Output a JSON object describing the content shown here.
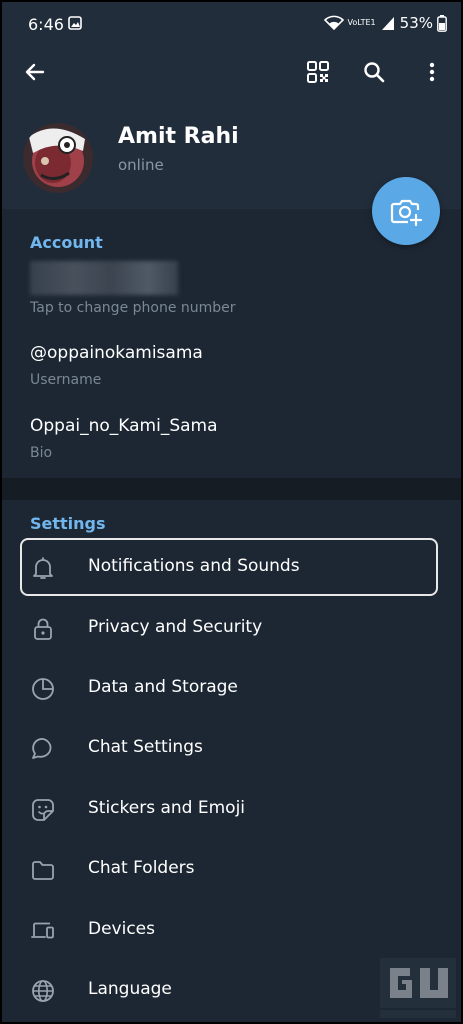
{
  "status_bar": {
    "time": "6:46",
    "battery": "53%",
    "network": "VoLTE1"
  },
  "header": {
    "back_icon": "arrow-left-icon",
    "qr_icon": "qr-code-icon",
    "search_icon": "search-icon",
    "more_icon": "more-vertical-icon"
  },
  "profile": {
    "name": "Amit Rahi",
    "status": "online"
  },
  "account": {
    "section_title": "Account",
    "phone_hint": "Tap to change phone number",
    "username": "@oppainokamisama",
    "username_label": "Username",
    "bio": "Oppai_no_Kami_Sama",
    "bio_label": "Bio"
  },
  "settings": {
    "section_title": "Settings",
    "items": [
      {
        "label": "Notifications and Sounds",
        "icon": "bell-icon"
      },
      {
        "label": "Privacy and Security",
        "icon": "lock-icon"
      },
      {
        "label": "Data and Storage",
        "icon": "pie-chart-icon"
      },
      {
        "label": "Chat Settings",
        "icon": "chat-bubble-icon"
      },
      {
        "label": "Stickers and Emoji",
        "icon": "sticker-icon"
      },
      {
        "label": "Chat Folders",
        "icon": "folder-icon"
      },
      {
        "label": "Devices",
        "icon": "devices-icon"
      },
      {
        "label": "Language",
        "icon": "globe-icon"
      }
    ]
  },
  "colors": {
    "background": "#1d2733",
    "header": "#212d3b",
    "accent": "#71b7ee",
    "fab": "#5aa9e6"
  }
}
